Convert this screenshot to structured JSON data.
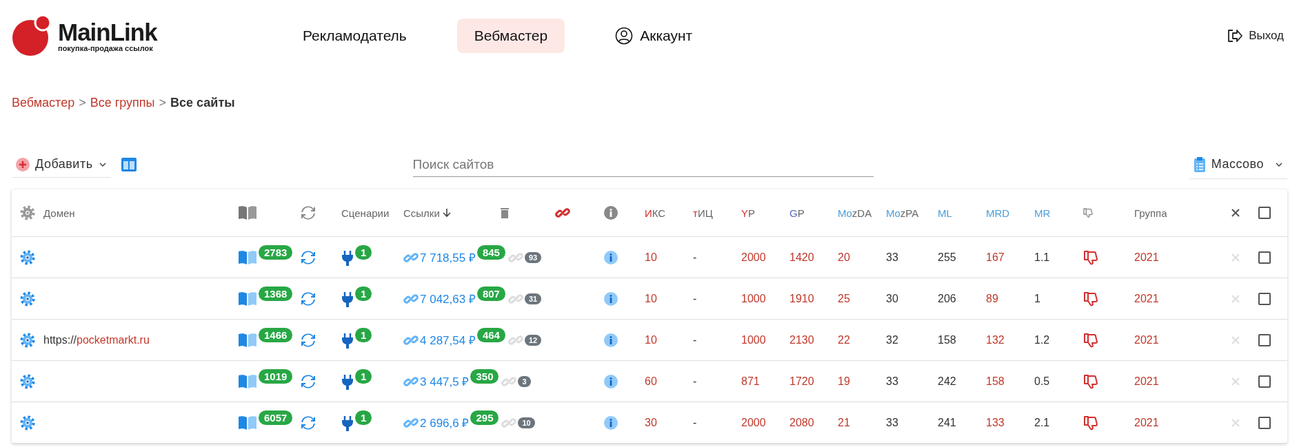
{
  "logo": {
    "name": "MainLink",
    "tagline": "покупка-продажа ссылок"
  },
  "nav": [
    {
      "label": "Рекламодатель",
      "selected": false,
      "kind": "text"
    },
    {
      "label": "Вебмастер",
      "selected": true,
      "kind": "text"
    },
    {
      "label": "Аккаунт",
      "selected": false,
      "kind": "account"
    }
  ],
  "logout": "Выход",
  "breadcrumbs": [
    {
      "label": "Вебмастер",
      "kind": "link"
    },
    {
      "label": "Все группы",
      "kind": "link"
    },
    {
      "label": "Все сайты",
      "kind": "current"
    }
  ],
  "breadcrumb_separator": ">",
  "toolbar": {
    "add": "Добавить",
    "search_placeholder": "Поиск сайтов",
    "bulk": "Массово"
  },
  "columns": {
    "domain": "Домен",
    "scenarios": "Сценарии",
    "links": "Ссылки",
    "group": "Группа",
    "select_all_checked": false
  },
  "metric_headers": [
    {
      "accent": "И",
      "rest": "КС",
      "color": "#d32f2f"
    },
    {
      "accent": "т",
      "rest": "ИЦ",
      "color": "#d32f2f"
    },
    {
      "accent": "Y",
      "rest": "P",
      "color": "#d32f2f"
    },
    {
      "accent": "G",
      "rest": "P",
      "color": "#5c6bc0"
    },
    {
      "accent": "Mo",
      "rest": "zDA",
      "color": "#4a9fd8"
    },
    {
      "accent": "Mo",
      "rest": "zPA",
      "color": "#4a9fd8"
    },
    {
      "accent": "ML",
      "color": "#4a9fd8"
    },
    {
      "accent": "MRD",
      "color": "#4a9fd8"
    },
    {
      "accent": "MR",
      "color": "#4a9fd8"
    }
  ],
  "rows": [
    {
      "pages": "2783",
      "scenarios": "1",
      "price": "7 718,55 ₽",
      "links": "845",
      "broken": "93",
      "metrics": [
        "10",
        "-",
        "2000",
        "1420",
        "20",
        "33",
        "255",
        "167",
        "1.1"
      ],
      "group": "2021",
      "checked": false
    },
    {
      "pages": "1368",
      "scenarios": "1",
      "price": "7 042,63 ₽",
      "links": "807",
      "broken": "31",
      "metrics": [
        "10",
        "-",
        "1000",
        "1910",
        "25",
        "30",
        "206",
        "89",
        "1"
      ],
      "group": "2021",
      "checked": false
    },
    {
      "domain_prefix": "https://",
      "domain": "pocketmarkt.ru",
      "pages": "1466",
      "scenarios": "1",
      "price": "4 287,54 ₽",
      "links": "464",
      "broken": "12",
      "metrics": [
        "10",
        "-",
        "1000",
        "2130",
        "22",
        "32",
        "158",
        "132",
        "1.2"
      ],
      "group": "2021",
      "checked": false
    },
    {
      "pages": "1019",
      "scenarios": "1",
      "price": "3 447,5 ₽",
      "links": "350",
      "broken": "3",
      "metrics": [
        "60",
        "-",
        "871",
        "1720",
        "19",
        "33",
        "242",
        "158",
        "0.5"
      ],
      "group": "2021",
      "checked": false
    },
    {
      "pages": "6057",
      "scenarios": "1",
      "price": "2 696,6 ₽",
      "links": "295",
      "broken": "10",
      "metrics": [
        "30",
        "-",
        "2000",
        "2080",
        "21",
        "33",
        "241",
        "133",
        "2.1"
      ],
      "group": "2021",
      "checked": false
    }
  ]
}
